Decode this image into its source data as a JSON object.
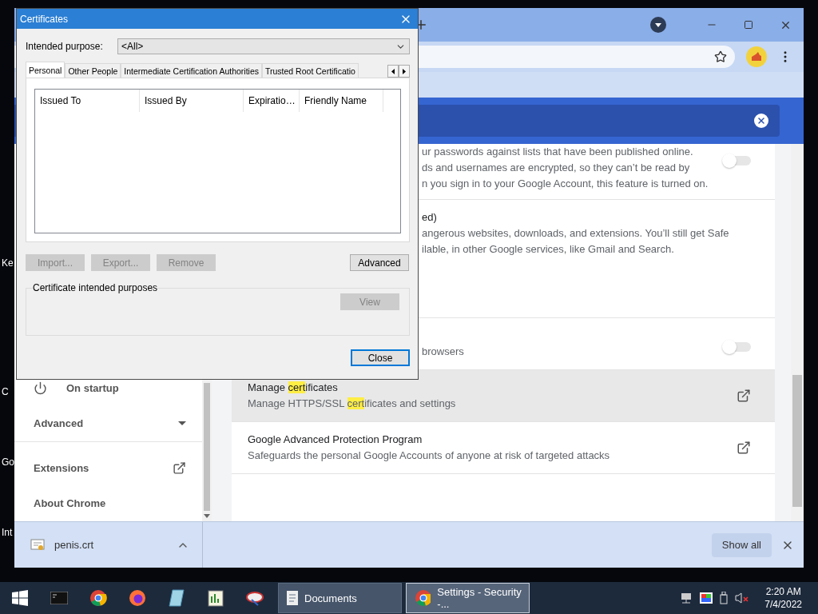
{
  "desktop_labels": [
    "Ke",
    "C",
    "Go",
    "Int"
  ],
  "browser": {
    "sidebar": {
      "items": [
        {
          "label": "On startup",
          "kind": "power"
        },
        {
          "label": "Advanced",
          "kind": "expander"
        },
        {
          "label": "Extensions",
          "kind": "external"
        },
        {
          "label": "About Chrome",
          "kind": "plain"
        }
      ]
    },
    "rows": [
      {
        "kind": "toggle",
        "on": false,
        "lines": [
          "ur passwords against lists that have been published online.",
          "ds and usernames are encrypted, so they can’t be read by",
          "n you sign in to your Google Account, this feature is turned on."
        ]
      },
      {
        "kind": "text",
        "title": "ed)",
        "lines": [
          "angerous websites, downloads, and extensions. You’ll still get Safe",
          "ilable, in other Google services, like Gmail and Search."
        ]
      },
      {
        "kind": "toggle",
        "on": false,
        "lines": [
          "browsers"
        ]
      },
      {
        "kind": "link",
        "highlighted": true,
        "title": [
          {
            "text": "Manage ",
            "match": false
          },
          {
            "text": "cert",
            "match": true
          },
          {
            "text": "ificates",
            "match": false
          }
        ],
        "subtitle": [
          {
            "text": "Manage HTTPS/SSL ",
            "match": false
          },
          {
            "text": "cert",
            "match": true
          },
          {
            "text": "ificates and settings",
            "match": false
          }
        ]
      },
      {
        "kind": "link",
        "highlighted": false,
        "title": [
          {
            "text": "Google Advanced Protection Program",
            "match": false
          }
        ],
        "subtitle": [
          {
            "text": "Safeguards the personal Google Accounts of anyone at risk of targeted attacks",
            "match": false
          }
        ]
      }
    ],
    "downloads": {
      "file": "penis.crt",
      "button": "Show all"
    }
  },
  "dialog": {
    "title": "Certificates",
    "purpose_label": "Intended purpose:",
    "purpose_value": "<All>",
    "tabs": [
      {
        "label": "Personal",
        "selected": true
      },
      {
        "label": "Other People",
        "selected": false
      },
      {
        "label": "Intermediate Certification Authorities",
        "selected": false
      },
      {
        "label": "Trusted Root Certificatio",
        "selected": false
      }
    ],
    "columns": [
      "Issued To",
      "Issued By",
      "Expiratio…",
      "Friendly Name"
    ],
    "buttons": [
      {
        "label": "Import...",
        "disabled": true
      },
      {
        "label": "Export...",
        "disabled": true
      },
      {
        "label": "Remove",
        "disabled": true
      },
      {
        "label": "Advanced",
        "disabled": false
      }
    ],
    "group": {
      "label": "Certificate intended purposes",
      "button": {
        "label": "View",
        "disabled": true
      }
    },
    "close_button": {
      "label": "Close",
      "disabled": false
    }
  },
  "taskbar": {
    "windows": [
      {
        "label": "Documents",
        "selected": false
      },
      {
        "label": "Settings - Security -...",
        "selected": true
      }
    ],
    "time": "2:20 AM",
    "date": "7/4/2022"
  }
}
